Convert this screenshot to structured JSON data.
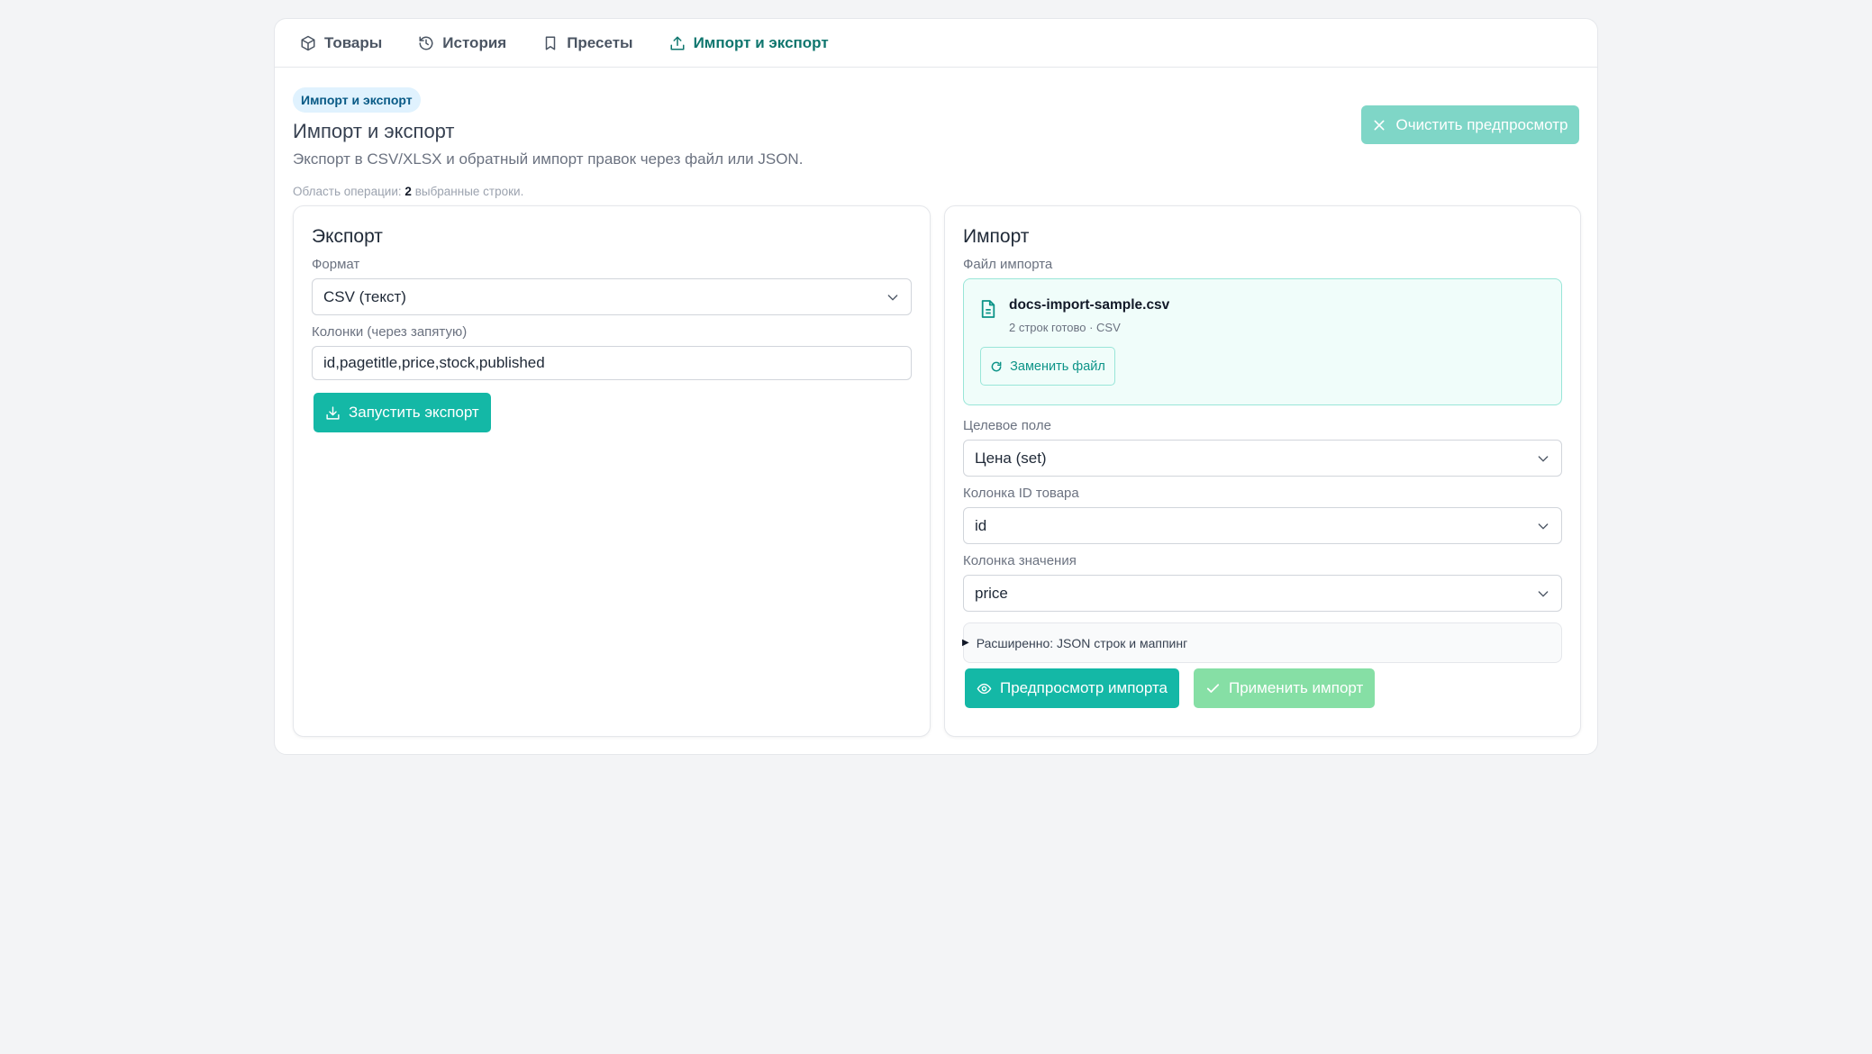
{
  "tabs": [
    {
      "label": "Товары",
      "icon": "box-icon"
    },
    {
      "label": "История",
      "icon": "history-icon"
    },
    {
      "label": "Пресеты",
      "icon": "bookmark-icon"
    },
    {
      "label": "Импорт и экспорт",
      "icon": "upload-icon",
      "active": true
    }
  ],
  "header": {
    "badge": "Импорт и экспорт",
    "title": "Импорт и экспорт",
    "description": "Экспорт в CSV/XLSX и обратный импорт правок через файл или JSON.",
    "scope_prefix": "Область операции:",
    "scope_count": "2",
    "scope_suffix": "выбранные строки.",
    "clear_preview_label": "Очистить предпросмотр"
  },
  "export": {
    "title": "Экспорт",
    "format_label": "Формат",
    "format_value": "CSV (текст)",
    "columns_label": "Колонки (через запятую)",
    "columns_value": "id,pagetitle,price,stock,published",
    "run_label": "Запустить экспорт"
  },
  "import": {
    "title": "Импорт",
    "file_label": "Файл импорта",
    "file_name": "docs-import-sample.csv",
    "file_meta": "2 строк готово · CSV",
    "replace_label": "Заменить файл",
    "target_label": "Целевое поле",
    "target_value": "Цена (set)",
    "id_col_label": "Колонка ID товара",
    "id_col_value": "id",
    "value_col_label": "Колонка значения",
    "value_col_value": "price",
    "advanced_label": "Расширенно: JSON строк и маппинг",
    "preview_label": "Предпросмотр импорта",
    "apply_label": "Применить импорт"
  },
  "colors": {
    "accent": "#14b8a6",
    "accent_dark": "#0f766e",
    "disabled_green": "#86dfa5",
    "clear_button": "#7fd6c7"
  }
}
